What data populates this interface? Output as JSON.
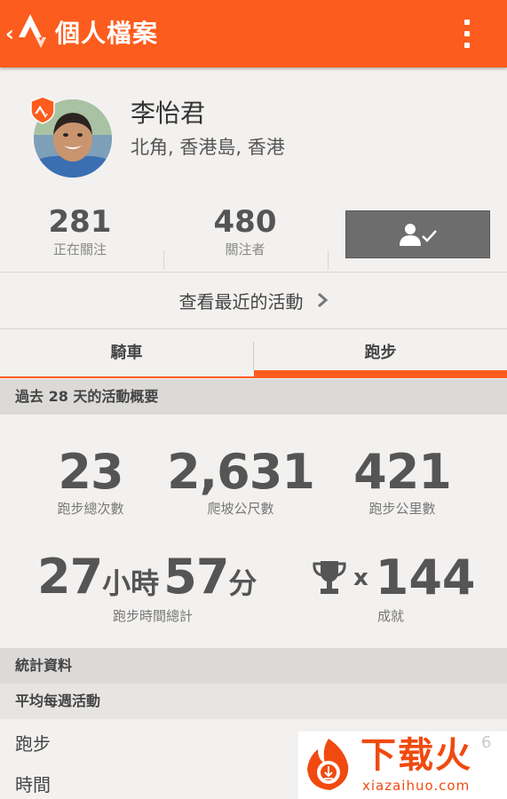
{
  "header": {
    "title": "個人檔案",
    "back_label": "‹"
  },
  "profile": {
    "name": "李怡君",
    "location": "北角, 香港島, 香港"
  },
  "counts": [
    {
      "value": "281",
      "label": "正在關注"
    },
    {
      "value": "480",
      "label": "關注者"
    }
  ],
  "recent_activity_label": "查看最近的活動",
  "tabs": [
    {
      "label": "騎車",
      "selected": false
    },
    {
      "label": "跑步",
      "selected": true
    }
  ],
  "summary": {
    "heading": "過去 28 天的活動概要",
    "stats": [
      {
        "value": "23",
        "label": "跑步總次數"
      },
      {
        "value": "2,631",
        "label": "爬坡公尺數"
      },
      {
        "value": "421",
        "label": "跑步公里數"
      }
    ],
    "time": {
      "hours": "27",
      "hours_unit": "小時",
      "minutes": "57",
      "minutes_unit": "分",
      "label": "跑步時間總計"
    },
    "achievements": {
      "times": "x",
      "value": "144",
      "label": "成就"
    }
  },
  "stats_section": {
    "heading": "統計資料",
    "subheading": "平均每週活動",
    "rows": [
      "跑步",
      "時間"
    ]
  },
  "watermark": {
    "text": "下载火",
    "url": "xiazaihuo.com",
    "digit": "6"
  },
  "colors": {
    "accent": "#fc5c1d",
    "button": "#6d6d6d",
    "background": "#f3f1ef"
  }
}
